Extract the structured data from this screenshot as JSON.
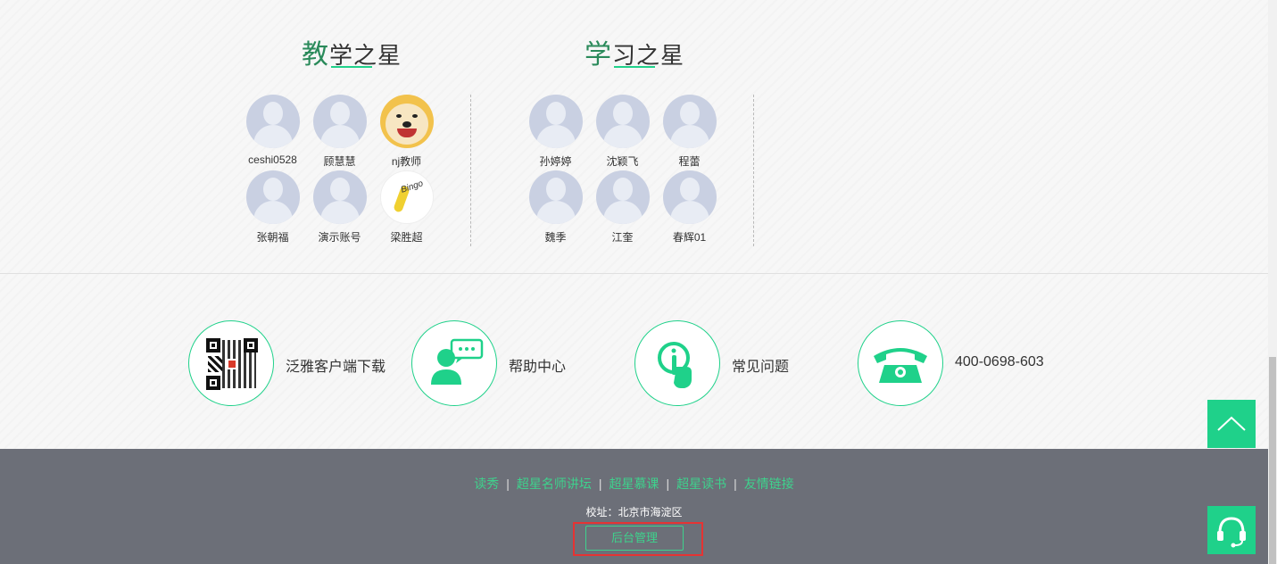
{
  "teaching_stars": {
    "title_first": "教",
    "title_rest": "学之星",
    "people": [
      {
        "name": "ceshi0528",
        "avatar": "default-avatar"
      },
      {
        "name": "顾慧慧",
        "avatar": "default-avatar"
      },
      {
        "name": "nj教师",
        "avatar": "dog-photo"
      },
      {
        "name": "张朝福",
        "avatar": "default-avatar"
      },
      {
        "name": "演示账号",
        "avatar": "default-avatar"
      },
      {
        "name": "梁胜超",
        "avatar": "bingo-sticker"
      }
    ]
  },
  "learning_stars": {
    "title_first": "学",
    "title_rest": "习之星",
    "people": [
      {
        "name": "孙婷婷",
        "avatar": "default-avatar"
      },
      {
        "name": "沈颖飞",
        "avatar": "default-avatar"
      },
      {
        "name": "程蕾",
        "avatar": "default-avatar"
      },
      {
        "name": "魏季",
        "avatar": "default-avatar"
      },
      {
        "name": "江奎",
        "avatar": "default-avatar"
      },
      {
        "name": "春辉01",
        "avatar": "default-avatar"
      }
    ]
  },
  "services": [
    {
      "label": "泛雅客户端下载",
      "icon": "qr-code-icon"
    },
    {
      "label": "帮助中心",
      "icon": "support-person-icon"
    },
    {
      "label": "常见问题",
      "icon": "info-touch-icon"
    },
    {
      "label": "400-0698-603",
      "icon": "telephone-icon"
    }
  ],
  "footer": {
    "links": [
      "读秀",
      "超星名师讲坛",
      "超星慕课",
      "超星读书",
      "友情链接"
    ],
    "separator": "|",
    "address": "校址：北京市海淀区",
    "admin_button": "后台管理"
  },
  "colors": {
    "accent": "#1fd18a",
    "link": "#3ed28d",
    "footer_bg": "#6c6f78",
    "highlight": "#e53333"
  }
}
